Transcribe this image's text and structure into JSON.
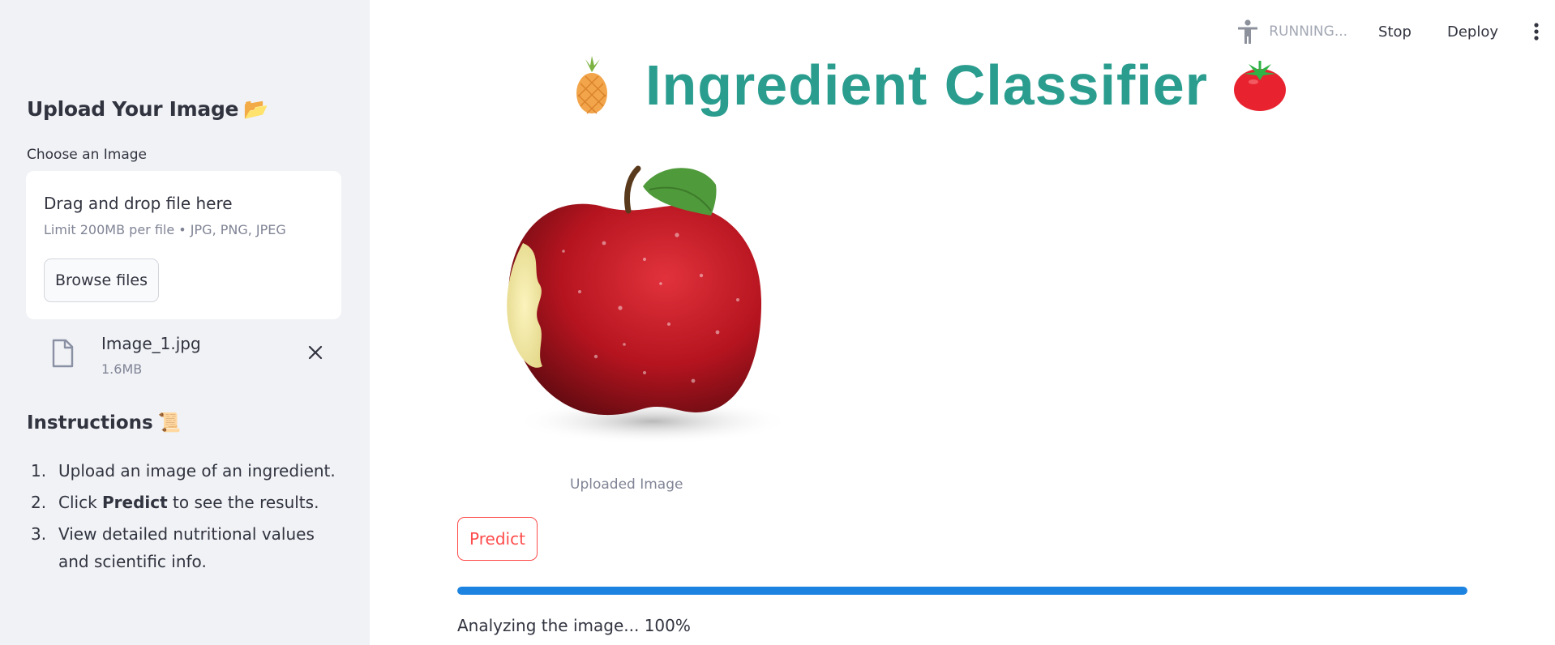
{
  "sidebar": {
    "upload_heading": "Upload Your Image",
    "upload_heading_emoji": "📂",
    "choose_label": "Choose an Image",
    "dropzone": {
      "title": "Drag and drop file here",
      "limit": "Limit 200MB per file • JPG, PNG, JPEG",
      "browse_label": "Browse files"
    },
    "file": {
      "name": "Image_1.jpg",
      "size": "1.6MB"
    },
    "instructions_heading": "Instructions",
    "instructions_emoji": "📜",
    "instructions": [
      {
        "num": "1.",
        "before": "Upload an image of an ingredient.",
        "bold": "",
        "after": ""
      },
      {
        "num": "2.",
        "before": "Click ",
        "bold": "Predict",
        "after": " to see the results."
      },
      {
        "num": "3.",
        "before": "View detailed nutritional values and scientific info.",
        "bold": "",
        "after": ""
      }
    ]
  },
  "toolbar": {
    "status": "RUNNING...",
    "stop_label": "Stop",
    "deploy_label": "Deploy"
  },
  "main": {
    "title": "Ingredient Classifier",
    "title_emoji_left": "🍍",
    "title_emoji_right": "🍅",
    "image_caption": "Uploaded Image",
    "predict_label": "Predict",
    "progress_fraction": 1.0,
    "progress_text": "Analyzing the image... 100%"
  },
  "colors": {
    "title": "#2a9d8f",
    "primary": "#ff4b4b",
    "progress": "#1c83e1",
    "sidebar_bg": "#f0f2f6"
  },
  "icons": [
    "accessibility-icon",
    "more-vertical-icon",
    "file-icon",
    "close-icon",
    "folder-emoji",
    "scroll-emoji",
    "pineapple-emoji",
    "tomato-emoji"
  ]
}
